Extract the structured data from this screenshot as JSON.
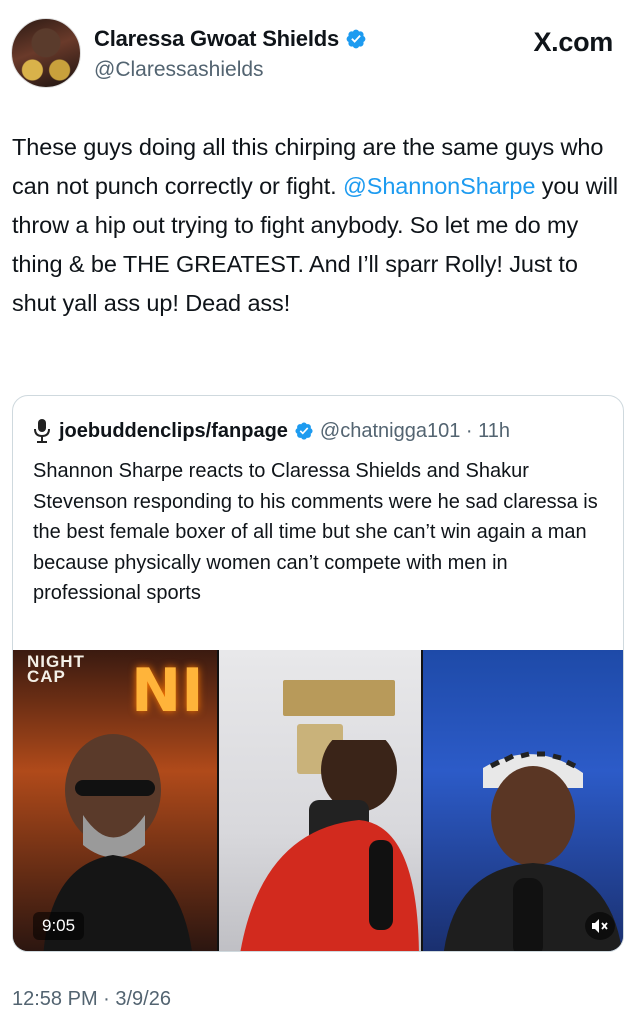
{
  "author": {
    "display_name": "Claressa Gwoat Shields",
    "handle": "@Claressashields",
    "verified": true
  },
  "brand": {
    "label": "X.com"
  },
  "tweet": {
    "segments": [
      {
        "text": "These guys doing all this chirping are the same guys who can not punch correctly or fight. ",
        "type": "text"
      },
      {
        "text": "@ShannonSharpe",
        "type": "mention"
      },
      {
        "text": " you will throw a hip out trying to fight anybody. So let me do my thing & be THE GREATEST. And I’ll sparr Rolly! Just to shut yall ass up! Dead ass!",
        "type": "text"
      }
    ],
    "timestamp": "12:58 PM · 3/9/26"
  },
  "quote": {
    "display_name": "joebuddenclips/fanpage",
    "handle_time": "@chatnigga101 · 11h",
    "text": "Shannon Sharpe reacts to Claressa Shields and Shakur Stevenson responding to his comments were he sad claressa is the best female boxer of all time but she can’t win again a man because physically women can’t compete with men in professional sports",
    "media": {
      "duration": "9:05",
      "logo_text": [
        "NIGHT",
        "CAP"
      ],
      "neon_text": "NI",
      "muted": true
    }
  },
  "colors": {
    "link": "#1d9bf0",
    "verified": "#1d9bf0",
    "secondary_text": "#536471",
    "border": "#cfd9de"
  },
  "icons": [
    "verified-badge-icon",
    "microphone-icon",
    "mute-icon"
  ]
}
